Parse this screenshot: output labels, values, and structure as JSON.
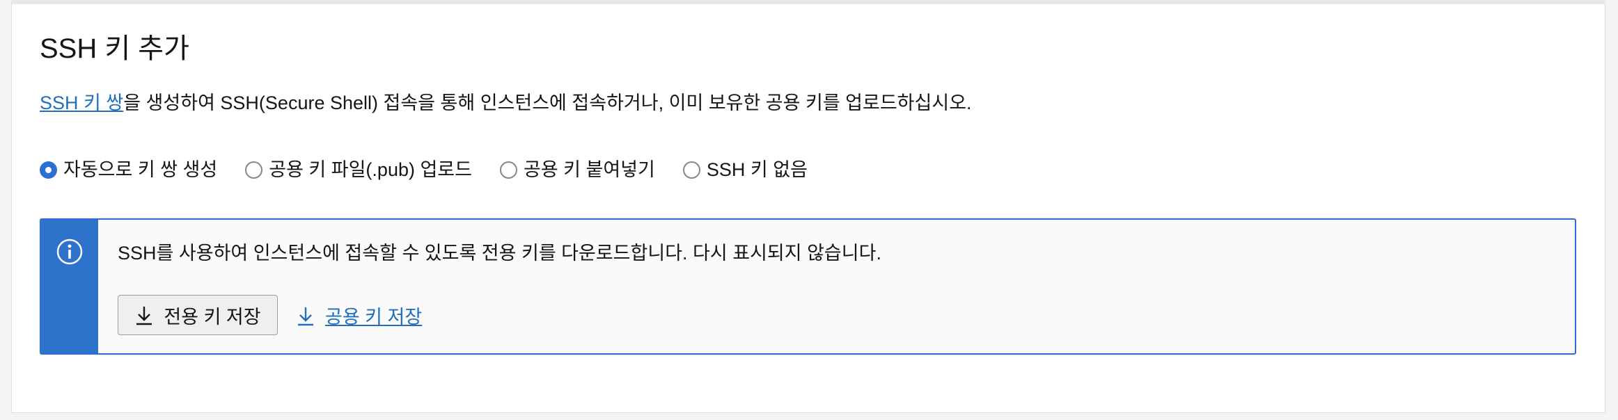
{
  "section": {
    "title": "SSH 키 추가",
    "description_link": "SSH 키 쌍",
    "description_rest": "을 생성하여 SSH(Secure Shell) 접속을 통해 인스턴스에 접속하거나, 이미 보유한 공용 키를 업로드하십시오."
  },
  "options": [
    {
      "label": "자동으로 키 쌍 생성",
      "selected": true
    },
    {
      "label": "공용 키 파일(.pub) 업로드",
      "selected": false
    },
    {
      "label": "공용 키 붙여넣기",
      "selected": false
    },
    {
      "label": "SSH 키 없음",
      "selected": false
    }
  ],
  "info": {
    "icon": "info-icon",
    "message": "SSH를 사용하여 인스턴스에 접속할 수 있도록 전용 키를 다운로드합니다. 다시 표시되지 않습니다.",
    "private_key_button": "전용 키 저장",
    "public_key_link": "공용 키 저장"
  },
  "colors": {
    "accent": "#2e72cc",
    "link": "#1f6ebf"
  }
}
